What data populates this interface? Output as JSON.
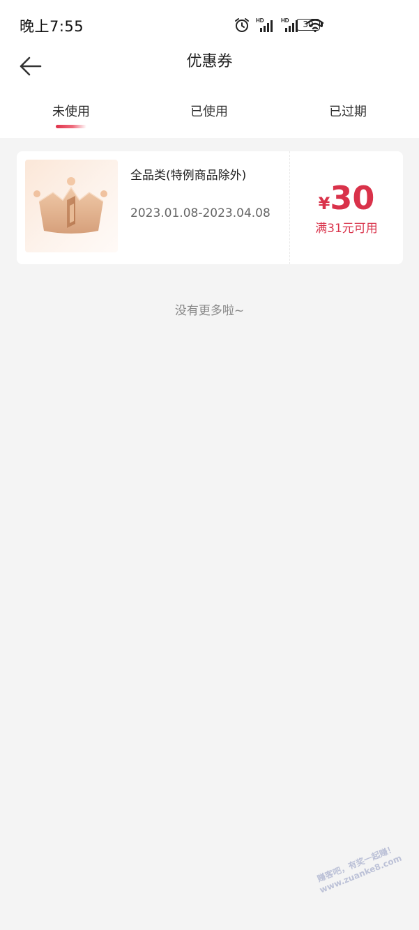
{
  "status_bar": {
    "time": "晚上7:55",
    "battery": "30",
    "icons": [
      "alarm-icon",
      "signal-hd-icon",
      "signal-hd-icon",
      "wifi-icon",
      "battery-icon"
    ]
  },
  "header": {
    "title": "优惠券",
    "back_icon": "back-arrow-icon"
  },
  "tabs": [
    {
      "label": "未使用",
      "active": true
    },
    {
      "label": "已使用",
      "active": false
    },
    {
      "label": "已过期",
      "active": false
    }
  ],
  "coupons": [
    {
      "title": "全品类(特例商品除外)",
      "date_range": "2023.01.08-2023.04.08",
      "currency": "¥",
      "amount": "30",
      "condition": "满31元可用",
      "thumbnail_icon": "crown-icon"
    }
  ],
  "footer_text": "没有更多啦~",
  "watermark": {
    "line1": "赚客吧，有奖一起赚！",
    "line2": "www.zuanke8.com"
  },
  "colors": {
    "accent": "#d9324a",
    "background": "#f4f4f4",
    "card": "#ffffff"
  }
}
